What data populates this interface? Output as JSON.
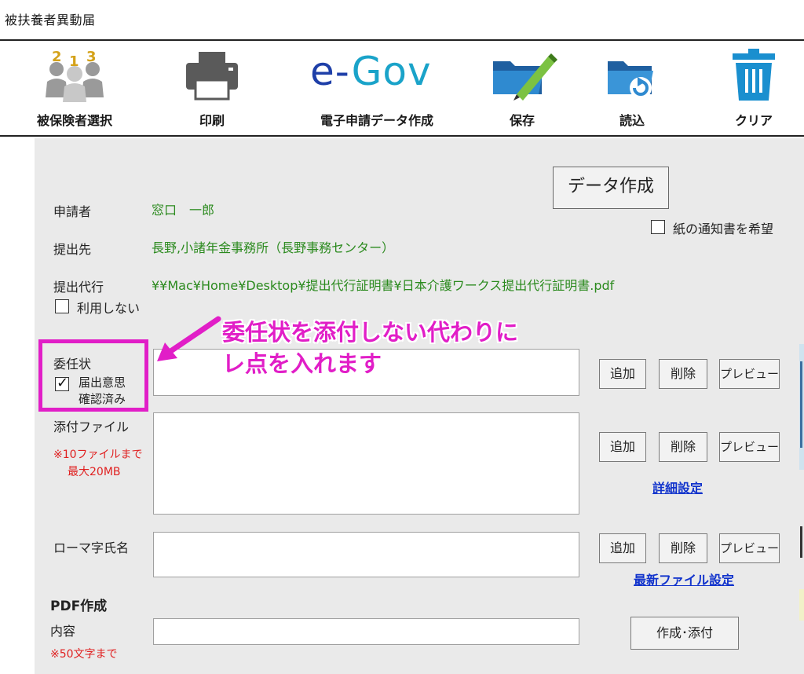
{
  "window": {
    "title": "被扶養者異動届"
  },
  "toolbar": {
    "items": [
      {
        "label": "被保険者選択",
        "icon": "insured-persons-icon"
      },
      {
        "label": "印刷",
        "icon": "printer-icon"
      },
      {
        "label": "電子申請データ作成",
        "icon": "egov-logo",
        "logo_text_e": "e-",
        "logo_text_gov": "Gov"
      },
      {
        "label": "保存",
        "icon": "save-folder-pen-icon"
      },
      {
        "label": "読込",
        "icon": "load-folder-icon"
      },
      {
        "label": "クリア",
        "icon": "trash-icon"
      }
    ]
  },
  "form": {
    "create_data_button": "データ作成",
    "paper_notice_checkbox": {
      "label": "紙の通知書を希望",
      "checked": false
    },
    "applicant": {
      "label": "申請者",
      "value": "窓口　一郎"
    },
    "submit_to": {
      "label": "提出先",
      "value": "長野,小諸年金事務所（長野事務センター）"
    },
    "proxy": {
      "label": "提出代行",
      "value": "¥¥Mac¥Home¥Desktop¥提出代行証明書¥日本介護ワークス提出代行証明書.pdf",
      "not_use_checkbox": {
        "label": "利用しない",
        "checked": false
      }
    },
    "power_of_attorney": {
      "label": "委任状",
      "confirmed_checkbox": {
        "label_line1": "届出意思",
        "label_line2": "確認済み",
        "checked": true
      },
      "buttons": {
        "add": "追加",
        "delete": "削除",
        "preview": "プレビュー"
      }
    },
    "attachments": {
      "label": "添付ファイル",
      "note_line1": "※10ファイルまで",
      "note_line2": "最大20MB",
      "buttons": {
        "add": "追加",
        "delete": "削除",
        "preview": "プレビュー"
      },
      "detail_link": "詳細設定"
    },
    "romaji_name": {
      "label": "ローマ字氏名",
      "buttons": {
        "add": "追加",
        "delete": "削除",
        "preview": "プレビュー"
      },
      "latest_file_link": "最新ファイル設定"
    },
    "pdf": {
      "heading": "PDF作成",
      "content_label": "内容",
      "note": "※50文字まで",
      "create_attach_button": "作成･添付"
    }
  },
  "annotation": {
    "line1": "委任状を添付しない代わりに",
    "line2": "レ点を入れます",
    "color": "#e11ec7"
  },
  "colors": {
    "value_green": "#2b8a1e",
    "note_red": "#e02020",
    "link_blue": "#1133cc",
    "panel_gray": "#eaeaea"
  }
}
